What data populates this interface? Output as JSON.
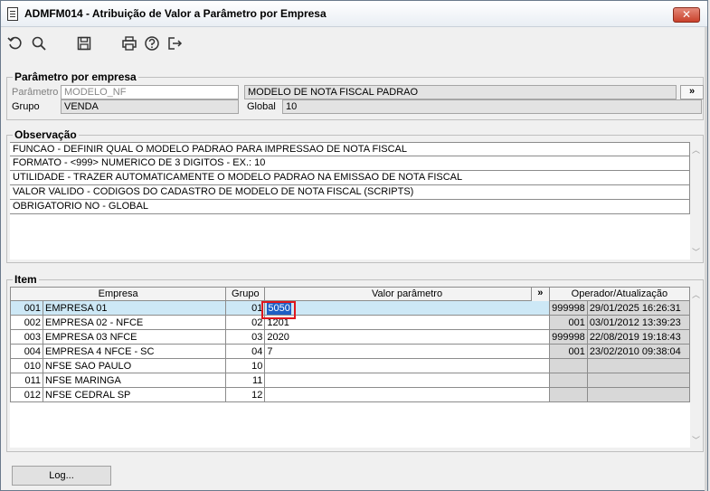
{
  "window": {
    "title": "ADMFM014 - Atribuição de Valor a Parâmetro por Empresa",
    "close_glyph": "✕"
  },
  "toolbar": {
    "icons": [
      "refresh-icon",
      "search-icon",
      "save-icon",
      "print-icon",
      "help-icon",
      "exit-icon"
    ]
  },
  "param_group": {
    "title": "Parâmetro por empresa",
    "parametro_label": "Parâmetro",
    "parametro_value": "MODELO_NF",
    "descricao_value": "MODELO DE NOTA FISCAL PADRAO",
    "expand_label": "»",
    "grupo_label": "Grupo",
    "grupo_value": "VENDA",
    "global_label": "Global",
    "global_value": "10"
  },
  "observacao": {
    "title": "Observação",
    "lines": [
      "FUNCAO - DEFINIR QUAL O MODELO PADRAO PARA IMPRESSAO DE NOTA FISCAL",
      "FORMATO - <999> NUMERICO DE 3 DIGITOS - EX.: 10",
      "UTILIDADE - TRAZER AUTOMATICAMENTE O MODELO PADRAO NA EMISSAO DE NOTA FISCAL",
      "VALOR VALIDO - CODIGOS DO CADASTRO DE MODELO DE NOTA FISCAL (SCRIPTS)",
      "OBRIGATORIO NO - GLOBAL"
    ]
  },
  "item": {
    "title": "Item",
    "headers": {
      "empresa": "Empresa",
      "grupo": "Grupo",
      "valor": "Valor parâmetro",
      "valor_btn": "»",
      "operador": "Operador/Atualização"
    },
    "rows": [
      {
        "code": "001",
        "empresa": "EMPRESA 01",
        "grupo": "01",
        "valor": "5050",
        "operador": "999998",
        "data": "29/01/2025 16:26:31"
      },
      {
        "code": "002",
        "empresa": "EMPRESA 02 - NFCE",
        "grupo": "02",
        "valor": "1201",
        "operador": "001",
        "data": "03/01/2012 13:39:23"
      },
      {
        "code": "003",
        "empresa": "EMPRESA 03 NFCE",
        "grupo": "03",
        "valor": "2020",
        "operador": "999998",
        "data": "22/08/2019 19:18:43"
      },
      {
        "code": "004",
        "empresa": "EMPRESA 4 NFCE - SC",
        "grupo": "04",
        "valor": "7",
        "operador": "001",
        "data": "23/02/2010 09:38:04"
      },
      {
        "code": "010",
        "empresa": "NFSE SAO PAULO",
        "grupo": "10",
        "valor": "",
        "operador": "",
        "data": ""
      },
      {
        "code": "011",
        "empresa": "NFSE MARINGA",
        "grupo": "11",
        "valor": "",
        "operador": "",
        "data": ""
      },
      {
        "code": "012",
        "empresa": "NFSE CEDRAL SP",
        "grupo": "12",
        "valor": "",
        "operador": "",
        "data": ""
      }
    ]
  },
  "footer": {
    "log_label": "Log..."
  }
}
